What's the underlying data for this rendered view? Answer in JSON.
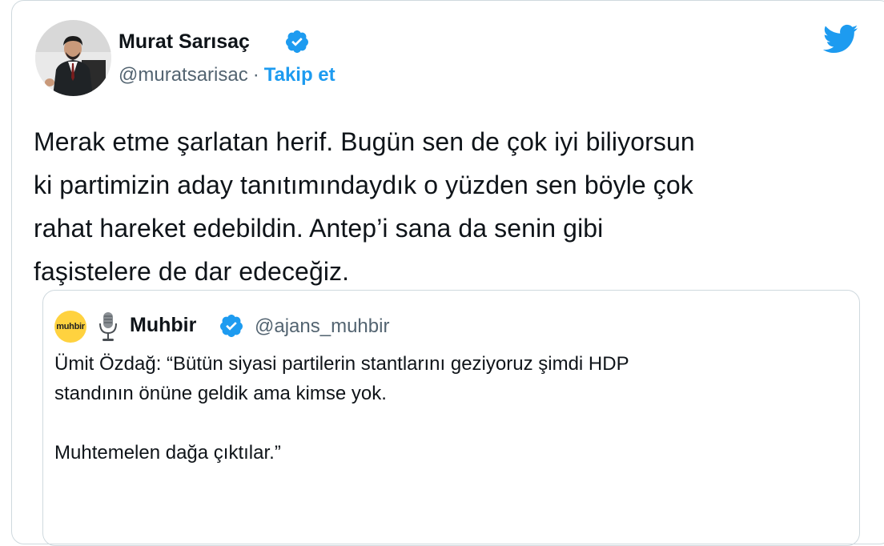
{
  "author": {
    "name": "Murat Sarısaç",
    "handle": "@muratsarisac",
    "separator": "·",
    "follow_label": "Takip et"
  },
  "tweet": {
    "text": "Merak etme şarlatan herif. Bugün sen de çok iyi biliyorsun\nki partimizin aday tanıtımındaydık o yüzden sen böyle çok\nrahat hareket edebildin. Antep’i sana da senin gibi\nfaşistelere de dar edeceğiz."
  },
  "quoted": {
    "avatar_label": "muhbir",
    "name": "Muhbir",
    "handle": "@ajans_muhbir",
    "text": "Ümit Özdağ: “Bütün siyasi partilerin stantlarını geziyoruz şimdi HDP\nstandının önüne geldik ama kimse yok.\n\nMuhtemelen dağa çıktılar.”"
  },
  "colors": {
    "accent": "#1d9bf0",
    "muted": "#536471",
    "border": "#cfd9de",
    "quote_avatar_bg": "#ffd23f"
  },
  "icons": {
    "verified": "verified-badge-icon",
    "brand": "twitter-bird-icon",
    "mic": "microphone-emoji-icon"
  }
}
